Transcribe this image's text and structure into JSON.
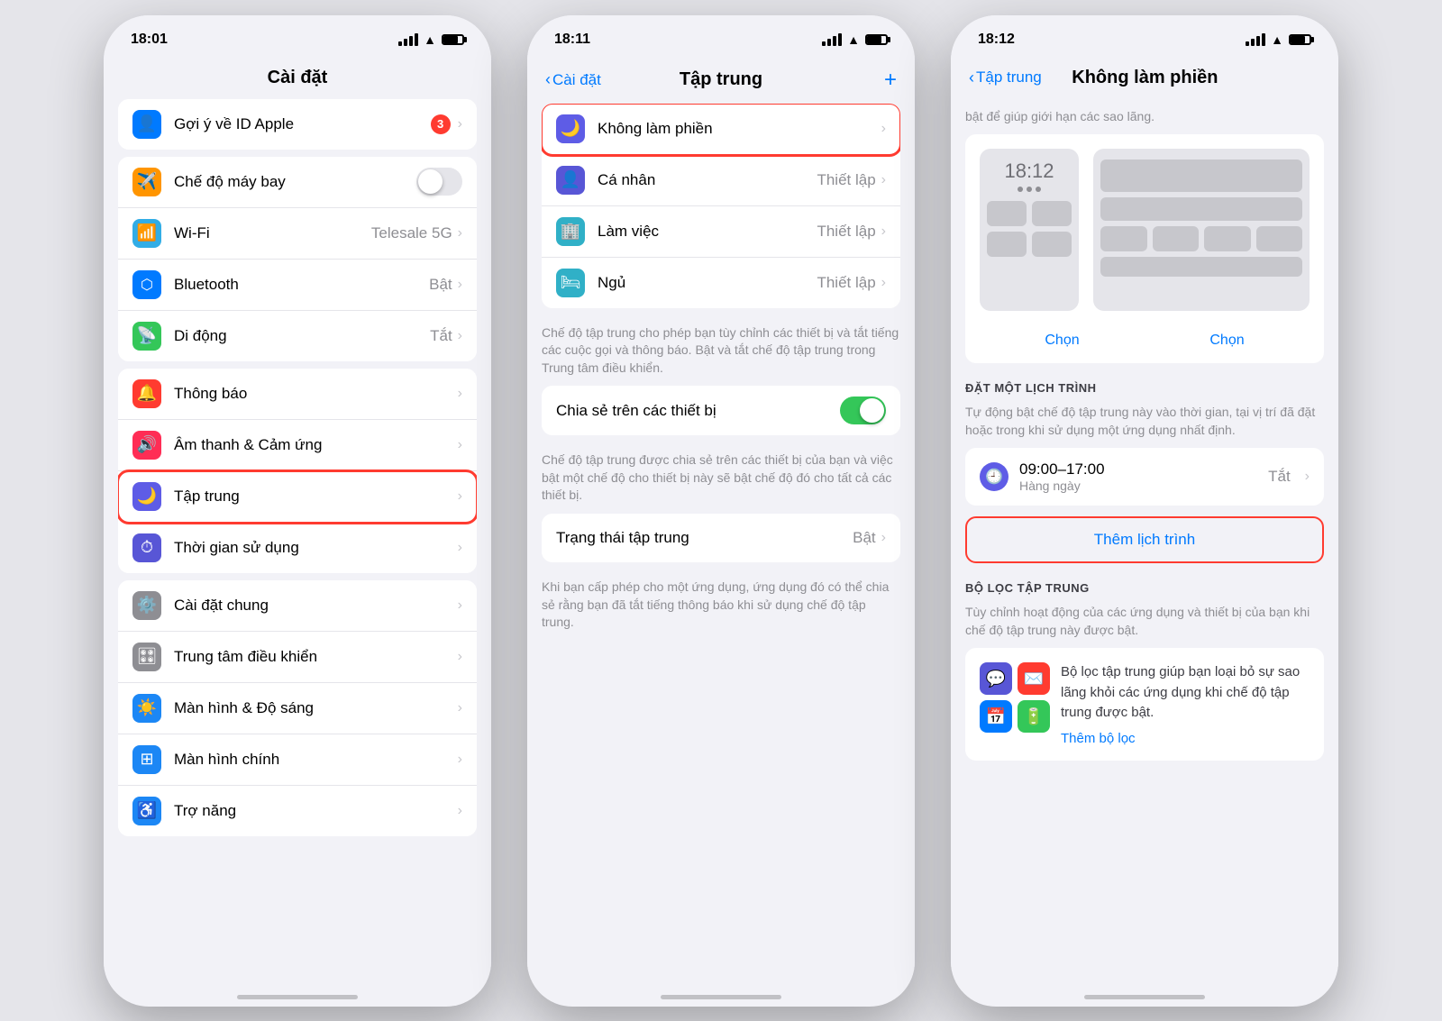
{
  "screen1": {
    "status_time": "18:01",
    "title": "Cài đặt",
    "items_section1": [
      {
        "label": "Gợi ý về ID Apple",
        "badge": "3",
        "icon": "👤",
        "icon_bg": "bg-blue",
        "value": "",
        "chevron": true
      }
    ],
    "items_section2": [
      {
        "label": "Chế độ máy bay",
        "icon": "✈️",
        "icon_bg": "bg-orange",
        "value": "",
        "toggle": true,
        "toggle_state": "off"
      },
      {
        "label": "Wi-Fi",
        "icon": "📶",
        "icon_bg": "bg-blue2",
        "value": "Telesale 5G",
        "chevron": true
      },
      {
        "label": "Bluetooth",
        "icon": "🔵",
        "icon_bg": "bg-blue3",
        "value": "Bật",
        "chevron": true
      },
      {
        "label": "Di động",
        "icon": "📡",
        "icon_bg": "bg-green",
        "value": "Tắt",
        "chevron": true
      }
    ],
    "items_section3": [
      {
        "label": "Thông báo",
        "icon": "🔔",
        "icon_bg": "bg-red",
        "value": "",
        "chevron": true
      },
      {
        "label": "Âm thanh & Cảm ứng",
        "icon": "🔊",
        "icon_bg": "bg-pink",
        "value": "",
        "chevron": true
      },
      {
        "label": "Tập trung",
        "icon": "🌙",
        "icon_bg": "bg-indigo",
        "value": "",
        "chevron": true,
        "highlighted": true
      },
      {
        "label": "Thời gian sử dụng",
        "icon": "⏱",
        "icon_bg": "bg-purple",
        "value": "",
        "chevron": true
      }
    ],
    "items_section4": [
      {
        "label": "Cài đặt chung",
        "icon": "⚙️",
        "icon_bg": "bg-gray",
        "value": "",
        "chevron": true
      },
      {
        "label": "Trung tâm điều khiển",
        "icon": "🎛",
        "icon_bg": "bg-gray",
        "value": "",
        "chevron": true
      },
      {
        "label": "Màn hình & Độ sáng",
        "icon": "🌟",
        "icon_bg": "bg-blue-mid",
        "value": "",
        "chevron": true
      },
      {
        "label": "Màn hình chính",
        "icon": "⊞",
        "icon_bg": "bg-blue-mid",
        "value": "",
        "chevron": true
      },
      {
        "label": "Trợ năng",
        "icon": "♿",
        "icon_bg": "bg-blue-mid",
        "value": "",
        "chevron": true
      }
    ]
  },
  "screen2": {
    "status_time": "18:11",
    "nav_back": "Cài đặt",
    "title": "Tập trung",
    "nav_action": "+",
    "focus_items": [
      {
        "label": "Không làm phiền",
        "icon": "🌙",
        "icon_bg": "bg-indigo",
        "value": "",
        "chevron": true,
        "highlighted": true
      },
      {
        "label": "Cá nhân",
        "icon": "👤",
        "icon_bg": "bg-purple",
        "value": "Thiết lập",
        "chevron": true
      },
      {
        "label": "Làm việc",
        "icon": "🏢",
        "icon_bg": "bg-teal2",
        "value": "Thiết lập",
        "chevron": true
      },
      {
        "label": "Ngủ",
        "icon": "🛏",
        "icon_bg": "bg-teal2",
        "value": "Thiết lập",
        "chevron": true
      }
    ],
    "description1": "Chế độ tập trung cho phép bạn tùy chỉnh các thiết bị và tắt tiếng các cuộc gọi và thông báo. Bật và tắt chế độ tập trung trong Trung tâm điều khiển.",
    "share_label": "Chia sẻ trên các thiết bị",
    "share_toggle": "on",
    "description2": "Chế độ tập trung được chia sẻ trên các thiết bị của bạn và việc bật một chế độ cho thiết bị này sẽ bật chế độ đó cho tất cả các thiết bị.",
    "status_label": "Trạng thái tập trung",
    "status_value": "Bật",
    "description3": "Khi bạn cấp phép cho một ứng dụng, ứng dụng đó có thể chia sẻ rằng bạn đã tắt tiếng thông báo khi sử dụng chế độ tập trung."
  },
  "screen3": {
    "status_time": "18:12",
    "nav_back": "Tập trung",
    "title": "Không làm phiền",
    "top_description": "bật để giúp giới hạn các sao lãng.",
    "preview_time": "18:12",
    "choose_label1": "Chọn",
    "choose_label2": "Chọn",
    "schedule_section_header": "ĐẶT MỘT LỊCH TRÌNH",
    "schedule_description": "Tự động bật chế độ tập trung này vào thời gian, tại vị trí đã đặt hoặc trong khi sử dụng một ứng dụng nhất định.",
    "schedule_time": "09:00–17:00",
    "schedule_repeat": "Hàng ngày",
    "schedule_value": "Tắt",
    "add_schedule_label": "Thêm lịch trình",
    "filter_section_header": "BỘ LỌC TẬP TRUNG",
    "filter_description": "Tùy chỉnh hoạt động của các ứng dụng và thiết bị của bạn khi chế độ tập trung này được bật.",
    "filter_card_text": "Bộ lọc tập trung giúp bạn loại bỏ sự sao lãng khỏi các ứng dụng khi chế độ tập trung được bật.",
    "filter_add_link": "Thêm bộ lọc",
    "them_bo_loc": "Thêm bộ lọc"
  }
}
